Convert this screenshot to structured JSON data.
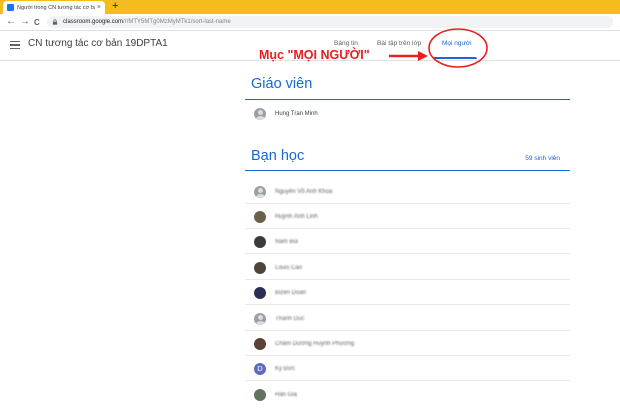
{
  "browser": {
    "tab_title": "Người trong CN tương tác cơ bả",
    "tab_close": "×",
    "new_tab": "+",
    "url_host": "classroom.google.com",
    "url_path": "/r/MTY5MTg0MzMyMTk1/sort-last-name",
    "back": "←",
    "forward": "→",
    "reload": "C"
  },
  "header": {
    "class_title": "CN tương tác cơ bản 19DPTA1",
    "tabs": [
      {
        "label": "Bảng tin",
        "active": false
      },
      {
        "label": "Bài tập trên lớp",
        "active": false
      },
      {
        "label": "Mọi người",
        "active": true
      }
    ]
  },
  "annotation": {
    "text": "Mục \"MỌI NGƯỜI\"",
    "color": "#e8201e"
  },
  "teachers": {
    "title": "Giáo viên",
    "people": [
      {
        "name": "Hung Tran Minh",
        "avatar": "generic"
      }
    ]
  },
  "classmates": {
    "title": "Bạn học",
    "count": "59 sinh viên",
    "people": [
      {
        "name": "Nguyễn Võ Anh Khoa",
        "avatar": "generic",
        "color": "#9aa0a6"
      },
      {
        "name": "Huỳnh Ánh Linh",
        "avatar": "photo",
        "color": "#6b6048"
      },
      {
        "name": "Nam Bùi",
        "avatar": "photo",
        "color": "#3d3a3a"
      },
      {
        "name": "Louis Cao",
        "avatar": "photo",
        "color": "#4e463a"
      },
      {
        "name": "Bizen Doan",
        "avatar": "photo",
        "color": "#2b2f55"
      },
      {
        "name": "Thanh Duc",
        "avatar": "generic",
        "color": "#9aa0a6"
      },
      {
        "name": "Châm Dương Huỳnh Phương",
        "avatar": "photo",
        "color": "#5b4038"
      },
      {
        "name": "Kỳ Đức",
        "avatar": "letter",
        "letter": "D",
        "color": "#5c6bc0"
      },
      {
        "name": "Hân Gia",
        "avatar": "photo",
        "color": "#5f7361"
      }
    ]
  },
  "colors": {
    "accent": "#1967d2",
    "chrome_tabstrip": "#f4bc1c"
  }
}
